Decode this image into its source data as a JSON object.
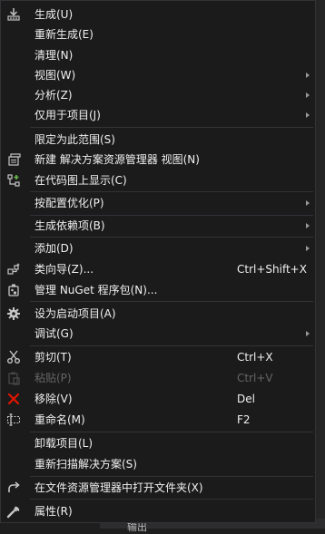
{
  "background": {
    "bottom_text": "输出"
  },
  "menu": {
    "build": "生成(U)",
    "rebuild": "重新生成(E)",
    "clean": "清理(N)",
    "view": "视图(W)",
    "analyze": "分析(Z)",
    "project_only": "仅用于项目(J)",
    "scope_to_this": "限定为此范围(S)",
    "new_solution_explorer_view": "新建 解决方案资源管理器 视图(N)",
    "show_on_code_map": "在代码图上显示(C)",
    "pgo": "按配置优化(P)",
    "build_dependencies": "生成依赖项(B)",
    "add": "添加(D)",
    "class_wizard": "类向导(Z)...",
    "class_wizard_shortcut": "Ctrl+Shift+X",
    "manage_nuget": "管理 NuGet 程序包(N)...",
    "set_startup": "设为启动项目(A)",
    "debug": "调试(G)",
    "cut": "剪切(T)",
    "cut_shortcut": "Ctrl+X",
    "paste": "粘贴(P)",
    "paste_shortcut": "Ctrl+V",
    "remove": "移除(V)",
    "remove_shortcut": "Del",
    "rename": "重命名(M)",
    "rename_shortcut": "F2",
    "unload": "卸载项目(L)",
    "rescan": "重新扫描解决方案(S)",
    "open_in_explorer": "在文件资源管理器中打开文件夹(X)",
    "properties": "属性(R)"
  },
  "icons": {
    "build": "build-icon",
    "new_view": "new-view-icon",
    "code_map": "code-map-icon",
    "class_wizard": "class-wizard-icon",
    "nuget": "nuget-package-icon",
    "startup": "gear-icon",
    "cut": "scissors-icon",
    "paste": "clipboard-icon",
    "remove": "red-x-icon",
    "rename": "rename-icon",
    "open_folder": "open-folder-arrow-icon",
    "properties": "wrench-icon"
  },
  "colors": {
    "menu_bg": "#1b1b1c",
    "text": "#f1f1f1",
    "disabled_text": "#656565",
    "remove_icon": "#e51400",
    "startup_icon": "#c5c5c5"
  }
}
